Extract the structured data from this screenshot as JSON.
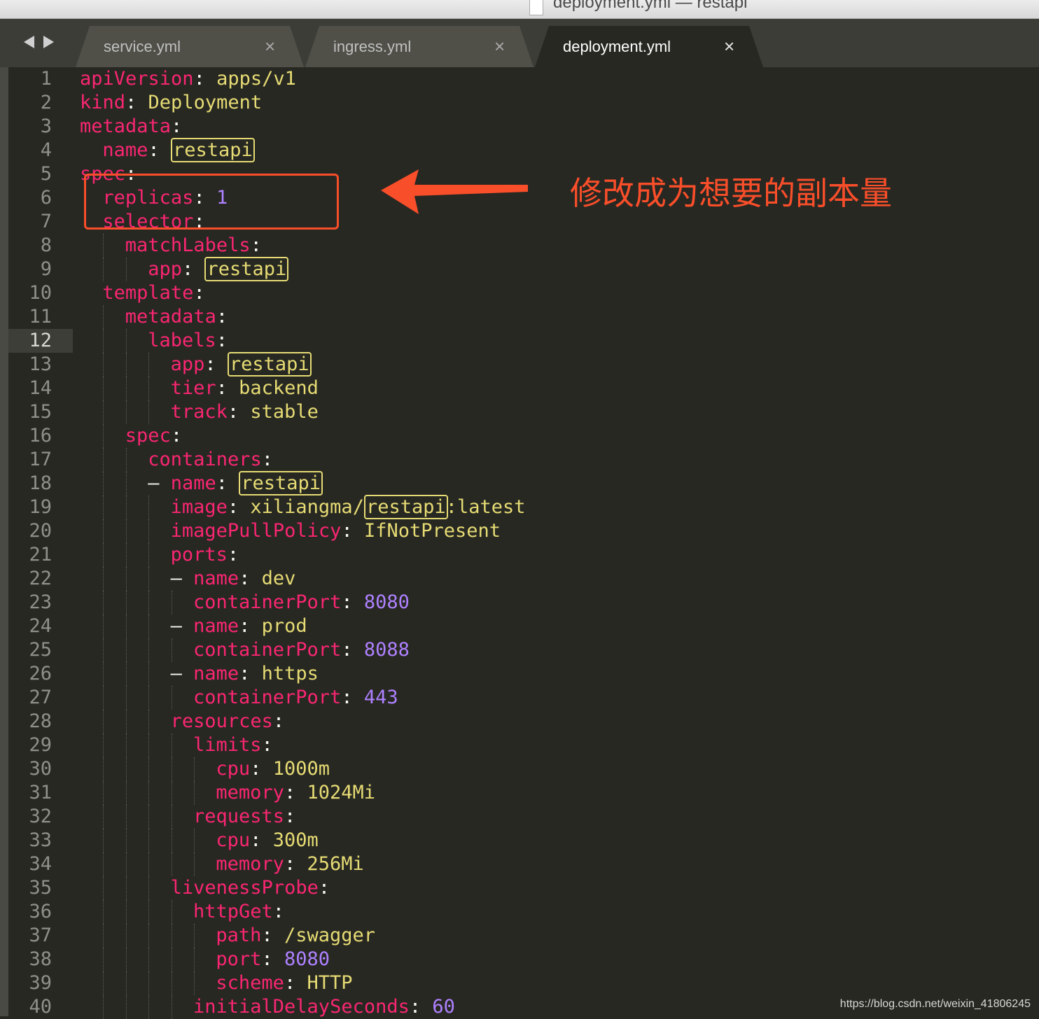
{
  "window": {
    "title": "deployment.yml — restapi"
  },
  "tabs": [
    {
      "label": "service.yml",
      "close": "×"
    },
    {
      "label": "ingress.yml",
      "close": "×"
    },
    {
      "label": "deployment.yml",
      "close": "×",
      "active": true
    }
  ],
  "editor": {
    "current_line": 12,
    "lines": [
      {
        "n": "1",
        "indent": 0,
        "tokens": [
          [
            "k",
            "apiVersion"
          ],
          [
            "p",
            ": "
          ],
          [
            "s",
            "apps/v1"
          ]
        ]
      },
      {
        "n": "2",
        "indent": 0,
        "tokens": [
          [
            "k",
            "kind"
          ],
          [
            "p",
            ": "
          ],
          [
            "s",
            "Deployment"
          ]
        ]
      },
      {
        "n": "3",
        "indent": 0,
        "tokens": [
          [
            "k",
            "metadata"
          ],
          [
            "p",
            ":"
          ]
        ]
      },
      {
        "n": "4",
        "indent": 1,
        "tokens": [
          [
            "k",
            "name"
          ],
          [
            "p",
            ": "
          ],
          [
            "hl",
            "restapi"
          ]
        ]
      },
      {
        "n": "5",
        "indent": 0,
        "tokens": [
          [
            "k",
            "spec"
          ],
          [
            "p",
            ":"
          ]
        ]
      },
      {
        "n": "6",
        "indent": 1,
        "tokens": [
          [
            "k",
            "replicas"
          ],
          [
            "p",
            ": "
          ],
          [
            "n",
            "1"
          ]
        ]
      },
      {
        "n": "7",
        "indent": 1,
        "tokens": [
          [
            "k",
            "selector"
          ],
          [
            "p",
            ":"
          ]
        ]
      },
      {
        "n": "8",
        "indent": 2,
        "tokens": [
          [
            "k",
            "matchLabels"
          ],
          [
            "p",
            ":"
          ]
        ]
      },
      {
        "n": "9",
        "indent": 3,
        "tokens": [
          [
            "k",
            "app"
          ],
          [
            "p",
            ": "
          ],
          [
            "hl",
            "restapi"
          ]
        ]
      },
      {
        "n": "10",
        "indent": 1,
        "tokens": [
          [
            "k",
            "template"
          ],
          [
            "p",
            ":"
          ]
        ]
      },
      {
        "n": "11",
        "indent": 2,
        "tokens": [
          [
            "k",
            "metadata"
          ],
          [
            "p",
            ":"
          ]
        ]
      },
      {
        "n": "12",
        "indent": 3,
        "tokens": [
          [
            "k",
            "labels"
          ],
          [
            "p",
            ":"
          ]
        ]
      },
      {
        "n": "13",
        "indent": 4,
        "tokens": [
          [
            "k",
            "app"
          ],
          [
            "p",
            ": "
          ],
          [
            "hl",
            "restapi"
          ]
        ]
      },
      {
        "n": "14",
        "indent": 4,
        "tokens": [
          [
            "k",
            "tier"
          ],
          [
            "p",
            ": "
          ],
          [
            "s",
            "backend"
          ]
        ]
      },
      {
        "n": "15",
        "indent": 4,
        "tokens": [
          [
            "k",
            "track"
          ],
          [
            "p",
            ": "
          ],
          [
            "s",
            "stable"
          ]
        ]
      },
      {
        "n": "16",
        "indent": 2,
        "tokens": [
          [
            "k",
            "spec"
          ],
          [
            "p",
            ":"
          ]
        ]
      },
      {
        "n": "17",
        "indent": 3,
        "tokens": [
          [
            "k",
            "containers"
          ],
          [
            "p",
            ":"
          ]
        ]
      },
      {
        "n": "18",
        "indent": 3,
        "tokens": [
          [
            "p",
            "– "
          ],
          [
            "k",
            "name"
          ],
          [
            "p",
            ": "
          ],
          [
            "hl",
            "restapi"
          ]
        ]
      },
      {
        "n": "19",
        "indent": 4,
        "tokens": [
          [
            "k",
            "image"
          ],
          [
            "p",
            ": "
          ],
          [
            "s",
            "xiliangma/"
          ],
          [
            "hl",
            "restapi"
          ],
          [
            "s",
            ":latest"
          ]
        ]
      },
      {
        "n": "20",
        "indent": 4,
        "tokens": [
          [
            "k",
            "imagePullPolicy"
          ],
          [
            "p",
            ": "
          ],
          [
            "s",
            "IfNotPresent"
          ]
        ]
      },
      {
        "n": "21",
        "indent": 4,
        "tokens": [
          [
            "k",
            "ports"
          ],
          [
            "p",
            ":"
          ]
        ]
      },
      {
        "n": "22",
        "indent": 4,
        "tokens": [
          [
            "p",
            "– "
          ],
          [
            "k",
            "name"
          ],
          [
            "p",
            ": "
          ],
          [
            "s",
            "dev"
          ]
        ]
      },
      {
        "n": "23",
        "indent": 5,
        "tokens": [
          [
            "k",
            "containerPort"
          ],
          [
            "p",
            ": "
          ],
          [
            "n",
            "8080"
          ]
        ]
      },
      {
        "n": "24",
        "indent": 4,
        "tokens": [
          [
            "p",
            "– "
          ],
          [
            "k",
            "name"
          ],
          [
            "p",
            ": "
          ],
          [
            "s",
            "prod"
          ]
        ]
      },
      {
        "n": "25",
        "indent": 5,
        "tokens": [
          [
            "k",
            "containerPort"
          ],
          [
            "p",
            ": "
          ],
          [
            "n",
            "8088"
          ]
        ]
      },
      {
        "n": "26",
        "indent": 4,
        "tokens": [
          [
            "p",
            "– "
          ],
          [
            "k",
            "name"
          ],
          [
            "p",
            ": "
          ],
          [
            "s",
            "https"
          ]
        ]
      },
      {
        "n": "27",
        "indent": 5,
        "tokens": [
          [
            "k",
            "containerPort"
          ],
          [
            "p",
            ": "
          ],
          [
            "n",
            "443"
          ]
        ]
      },
      {
        "n": "28",
        "indent": 4,
        "tokens": [
          [
            "k",
            "resources"
          ],
          [
            "p",
            ":"
          ]
        ]
      },
      {
        "n": "29",
        "indent": 5,
        "tokens": [
          [
            "k",
            "limits"
          ],
          [
            "p",
            ":"
          ]
        ]
      },
      {
        "n": "30",
        "indent": 6,
        "tokens": [
          [
            "k",
            "cpu"
          ],
          [
            "p",
            ": "
          ],
          [
            "s",
            "1000m"
          ]
        ]
      },
      {
        "n": "31",
        "indent": 6,
        "tokens": [
          [
            "k",
            "memory"
          ],
          [
            "p",
            ": "
          ],
          [
            "s",
            "1024Mi"
          ]
        ]
      },
      {
        "n": "32",
        "indent": 5,
        "tokens": [
          [
            "k",
            "requests"
          ],
          [
            "p",
            ":"
          ]
        ]
      },
      {
        "n": "33",
        "indent": 6,
        "tokens": [
          [
            "k",
            "cpu"
          ],
          [
            "p",
            ": "
          ],
          [
            "s",
            "300m"
          ]
        ]
      },
      {
        "n": "34",
        "indent": 6,
        "tokens": [
          [
            "k",
            "memory"
          ],
          [
            "p",
            ": "
          ],
          [
            "s",
            "256Mi"
          ]
        ]
      },
      {
        "n": "35",
        "indent": 4,
        "tokens": [
          [
            "k",
            "livenessProbe"
          ],
          [
            "p",
            ":"
          ]
        ]
      },
      {
        "n": "36",
        "indent": 5,
        "tokens": [
          [
            "k",
            "httpGet"
          ],
          [
            "p",
            ":"
          ]
        ]
      },
      {
        "n": "37",
        "indent": 6,
        "tokens": [
          [
            "k",
            "path"
          ],
          [
            "p",
            ": "
          ],
          [
            "s",
            "/swagger"
          ]
        ]
      },
      {
        "n": "38",
        "indent": 6,
        "tokens": [
          [
            "k",
            "port"
          ],
          [
            "p",
            ": "
          ],
          [
            "n",
            "8080"
          ]
        ]
      },
      {
        "n": "39",
        "indent": 6,
        "tokens": [
          [
            "k",
            "scheme"
          ],
          [
            "p",
            ": "
          ],
          [
            "s",
            "HTTP"
          ]
        ]
      },
      {
        "n": "40",
        "indent": 5,
        "tokens": [
          [
            "k",
            "initialDelaySeconds"
          ],
          [
            "p",
            ": "
          ],
          [
            "n",
            "60"
          ]
        ]
      }
    ]
  },
  "annotation": {
    "text": "修改成为想要的副本量",
    "color": "#f94e2a"
  },
  "watermark": "https://blog.csdn.net/weixin_41806245",
  "colors": {
    "background": "#272822",
    "key": "#f92672",
    "string": "#e6db74",
    "number": "#ae81ff"
  }
}
